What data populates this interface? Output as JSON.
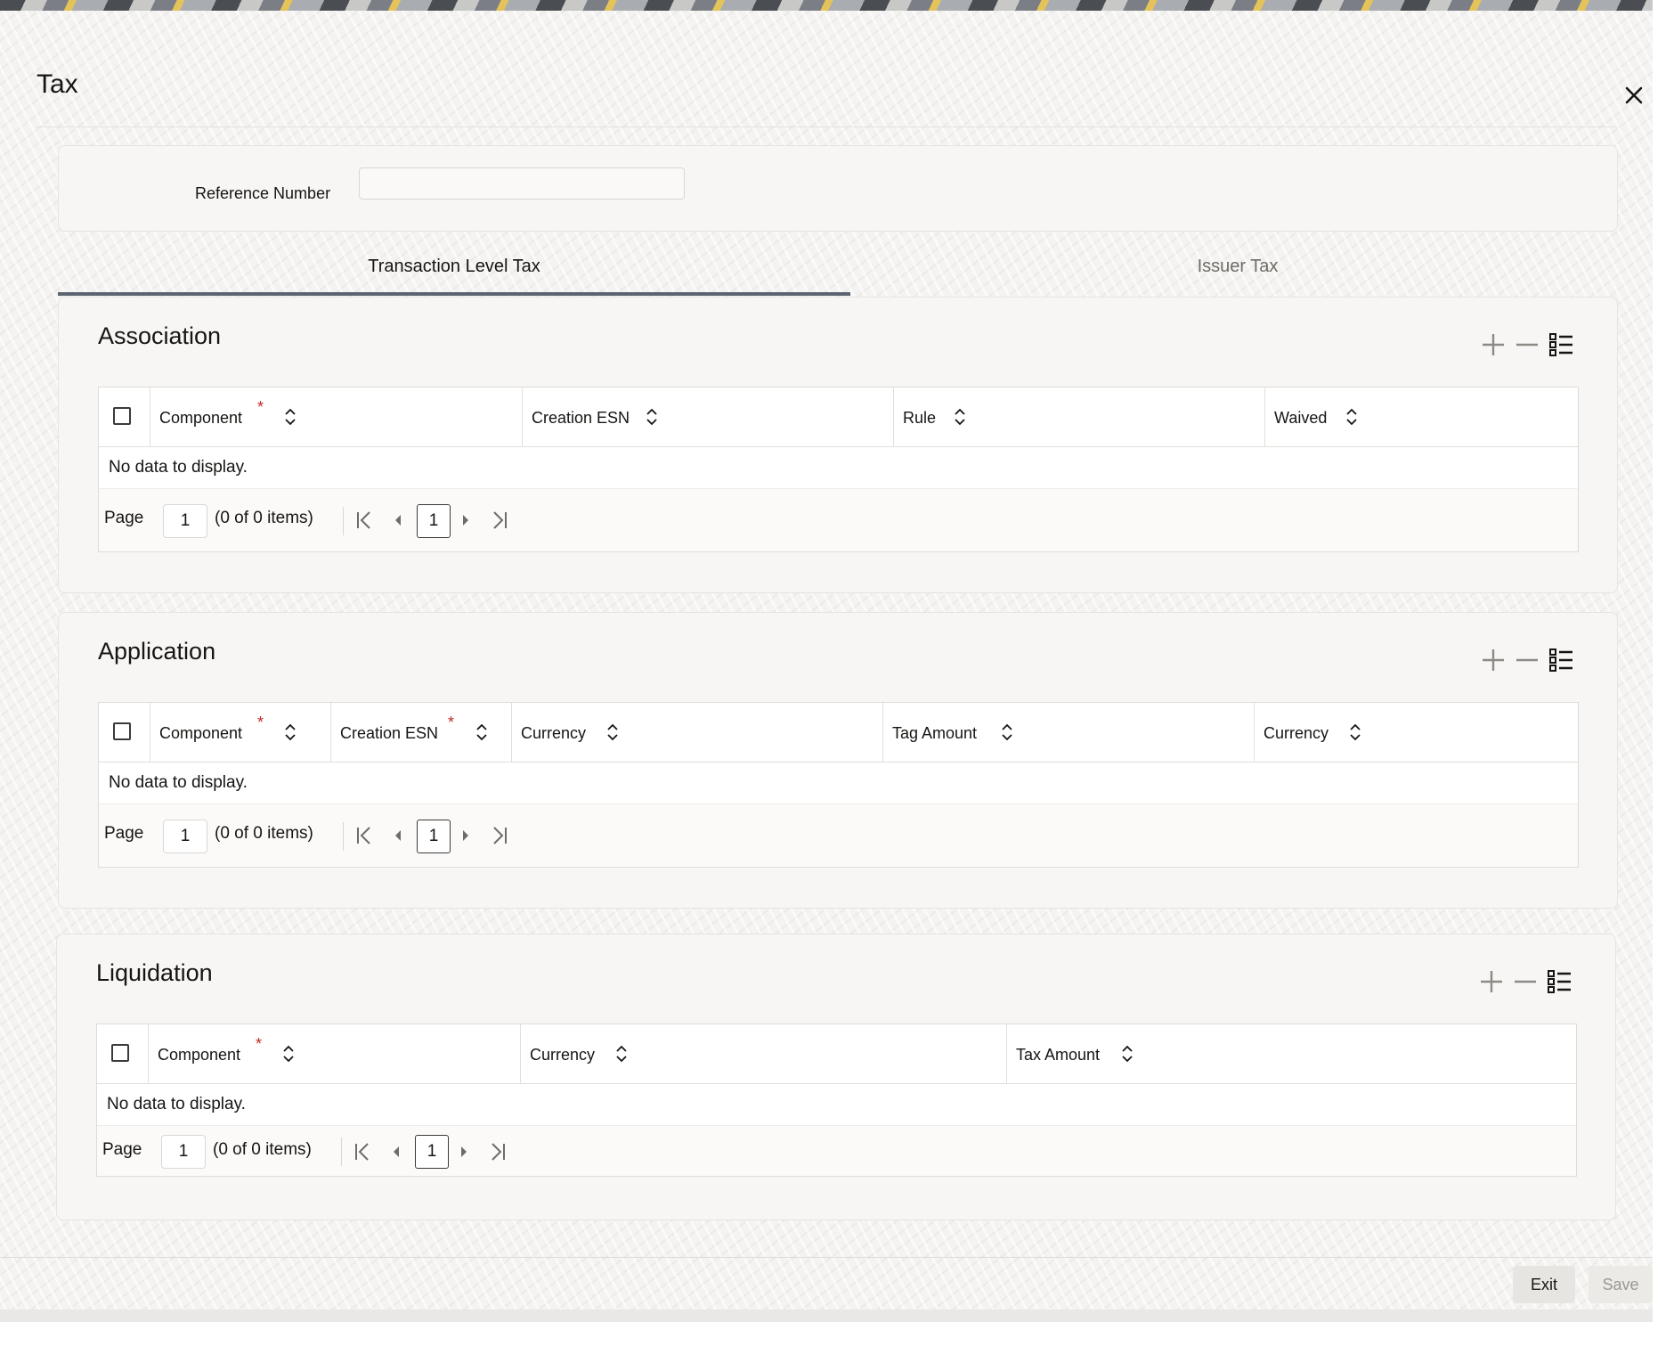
{
  "window": {
    "title": "Tax"
  },
  "reference": {
    "label": "Reference Number",
    "value": ""
  },
  "tabs": [
    {
      "label": "Transaction Level Tax",
      "active": true
    },
    {
      "label": "Issuer Tax",
      "active": false
    }
  ],
  "sections": {
    "association": {
      "title": "Association",
      "columns": [
        {
          "label": "Component",
          "required": true
        },
        {
          "label": "Creation ESN",
          "required": false
        },
        {
          "label": "Rule",
          "required": false
        },
        {
          "label": "Waived",
          "required": false
        }
      ],
      "empty_text": "No data to display.",
      "pager": {
        "label": "Page",
        "page": "1",
        "count": "(0 of 0 items)",
        "current": "1"
      }
    },
    "application": {
      "title": "Application",
      "columns": [
        {
          "label": "Component",
          "required": true
        },
        {
          "label": "Creation ESN",
          "required": true
        },
        {
          "label": "Currency",
          "required": false
        },
        {
          "label": "Tag Amount",
          "required": false
        },
        {
          "label": "Currency",
          "required": false
        }
      ],
      "empty_text": "No data to display.",
      "pager": {
        "label": "Page",
        "page": "1",
        "count": "(0 of 0 items)",
        "current": "1"
      }
    },
    "liquidation": {
      "title": "Liquidation",
      "columns": [
        {
          "label": "Component",
          "required": true
        },
        {
          "label": "Currency",
          "required": false
        },
        {
          "label": "Tax Amount",
          "required": false
        }
      ],
      "empty_text": "No data to display.",
      "pager": {
        "label": "Page",
        "page": "1",
        "count": "(0 of 0 items)",
        "current": "1"
      }
    }
  },
  "required_marker": "*",
  "footer": {
    "exit_label": "Exit",
    "save_label": "Save"
  },
  "icons": {
    "close": "close-icon",
    "add": "plus-icon",
    "remove": "minus-icon",
    "columns": "list-icon",
    "sort": "sort-icon",
    "first": "first-page-icon",
    "prev": "previous-page-icon",
    "next": "next-page-icon",
    "last": "last-page-icon"
  },
  "colors": {
    "required": "#c0292b",
    "tab_underline": "#5b6470",
    "disabled_text": "#9b9893"
  }
}
